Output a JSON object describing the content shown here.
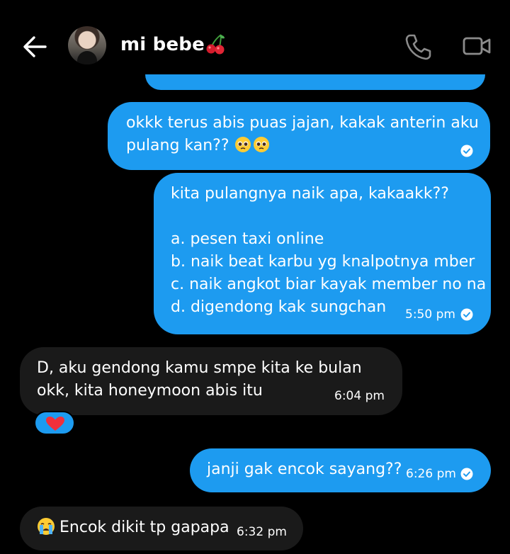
{
  "header": {
    "title": "mi bebe",
    "title_emoji": "cherries",
    "icons": [
      "back-arrow-icon",
      "avatar",
      "phone-icon",
      "video-call-icon"
    ]
  },
  "messages": [
    {
      "side": "outgoing",
      "lines": [
        "okkk terus abis puas jajan, kakak anterin aku",
        "pulang kan??"
      ],
      "emoji": [
        "pleading-face",
        "pleading-face"
      ],
      "time": "",
      "read": true
    },
    {
      "side": "outgoing",
      "lines": [
        "kita pulangnya naik apa, kakaakk??",
        "",
        "a. pesen taxi online",
        "b. naik beat karbu yg knalpotnya mber",
        "c. naik angkot biar kayak member no na",
        "d. digendong kak sungchan"
      ],
      "time": "5:50 pm",
      "read": true
    },
    {
      "side": "incoming",
      "lines": [
        "D, aku gendong kamu smpe kita ke bulan",
        "okk, kita honeymoon abis itu"
      ],
      "time": "6:04 pm",
      "reaction": "red-heart"
    },
    {
      "side": "outgoing",
      "lines": [
        "janji gak encok sayang??"
      ],
      "time": "6:26 pm",
      "read": true
    },
    {
      "side": "incoming",
      "lines": [
        "Encok dikit tp gapapa"
      ],
      "emoji": [
        "crying-face"
      ],
      "time": "6:32 pm"
    }
  ],
  "colors": {
    "background": "#000000",
    "outgoing_bubble": "#1d9bf0",
    "incoming_bubble": "#1a1a1a",
    "text": "#ffffff",
    "heart": "#f0303c"
  }
}
